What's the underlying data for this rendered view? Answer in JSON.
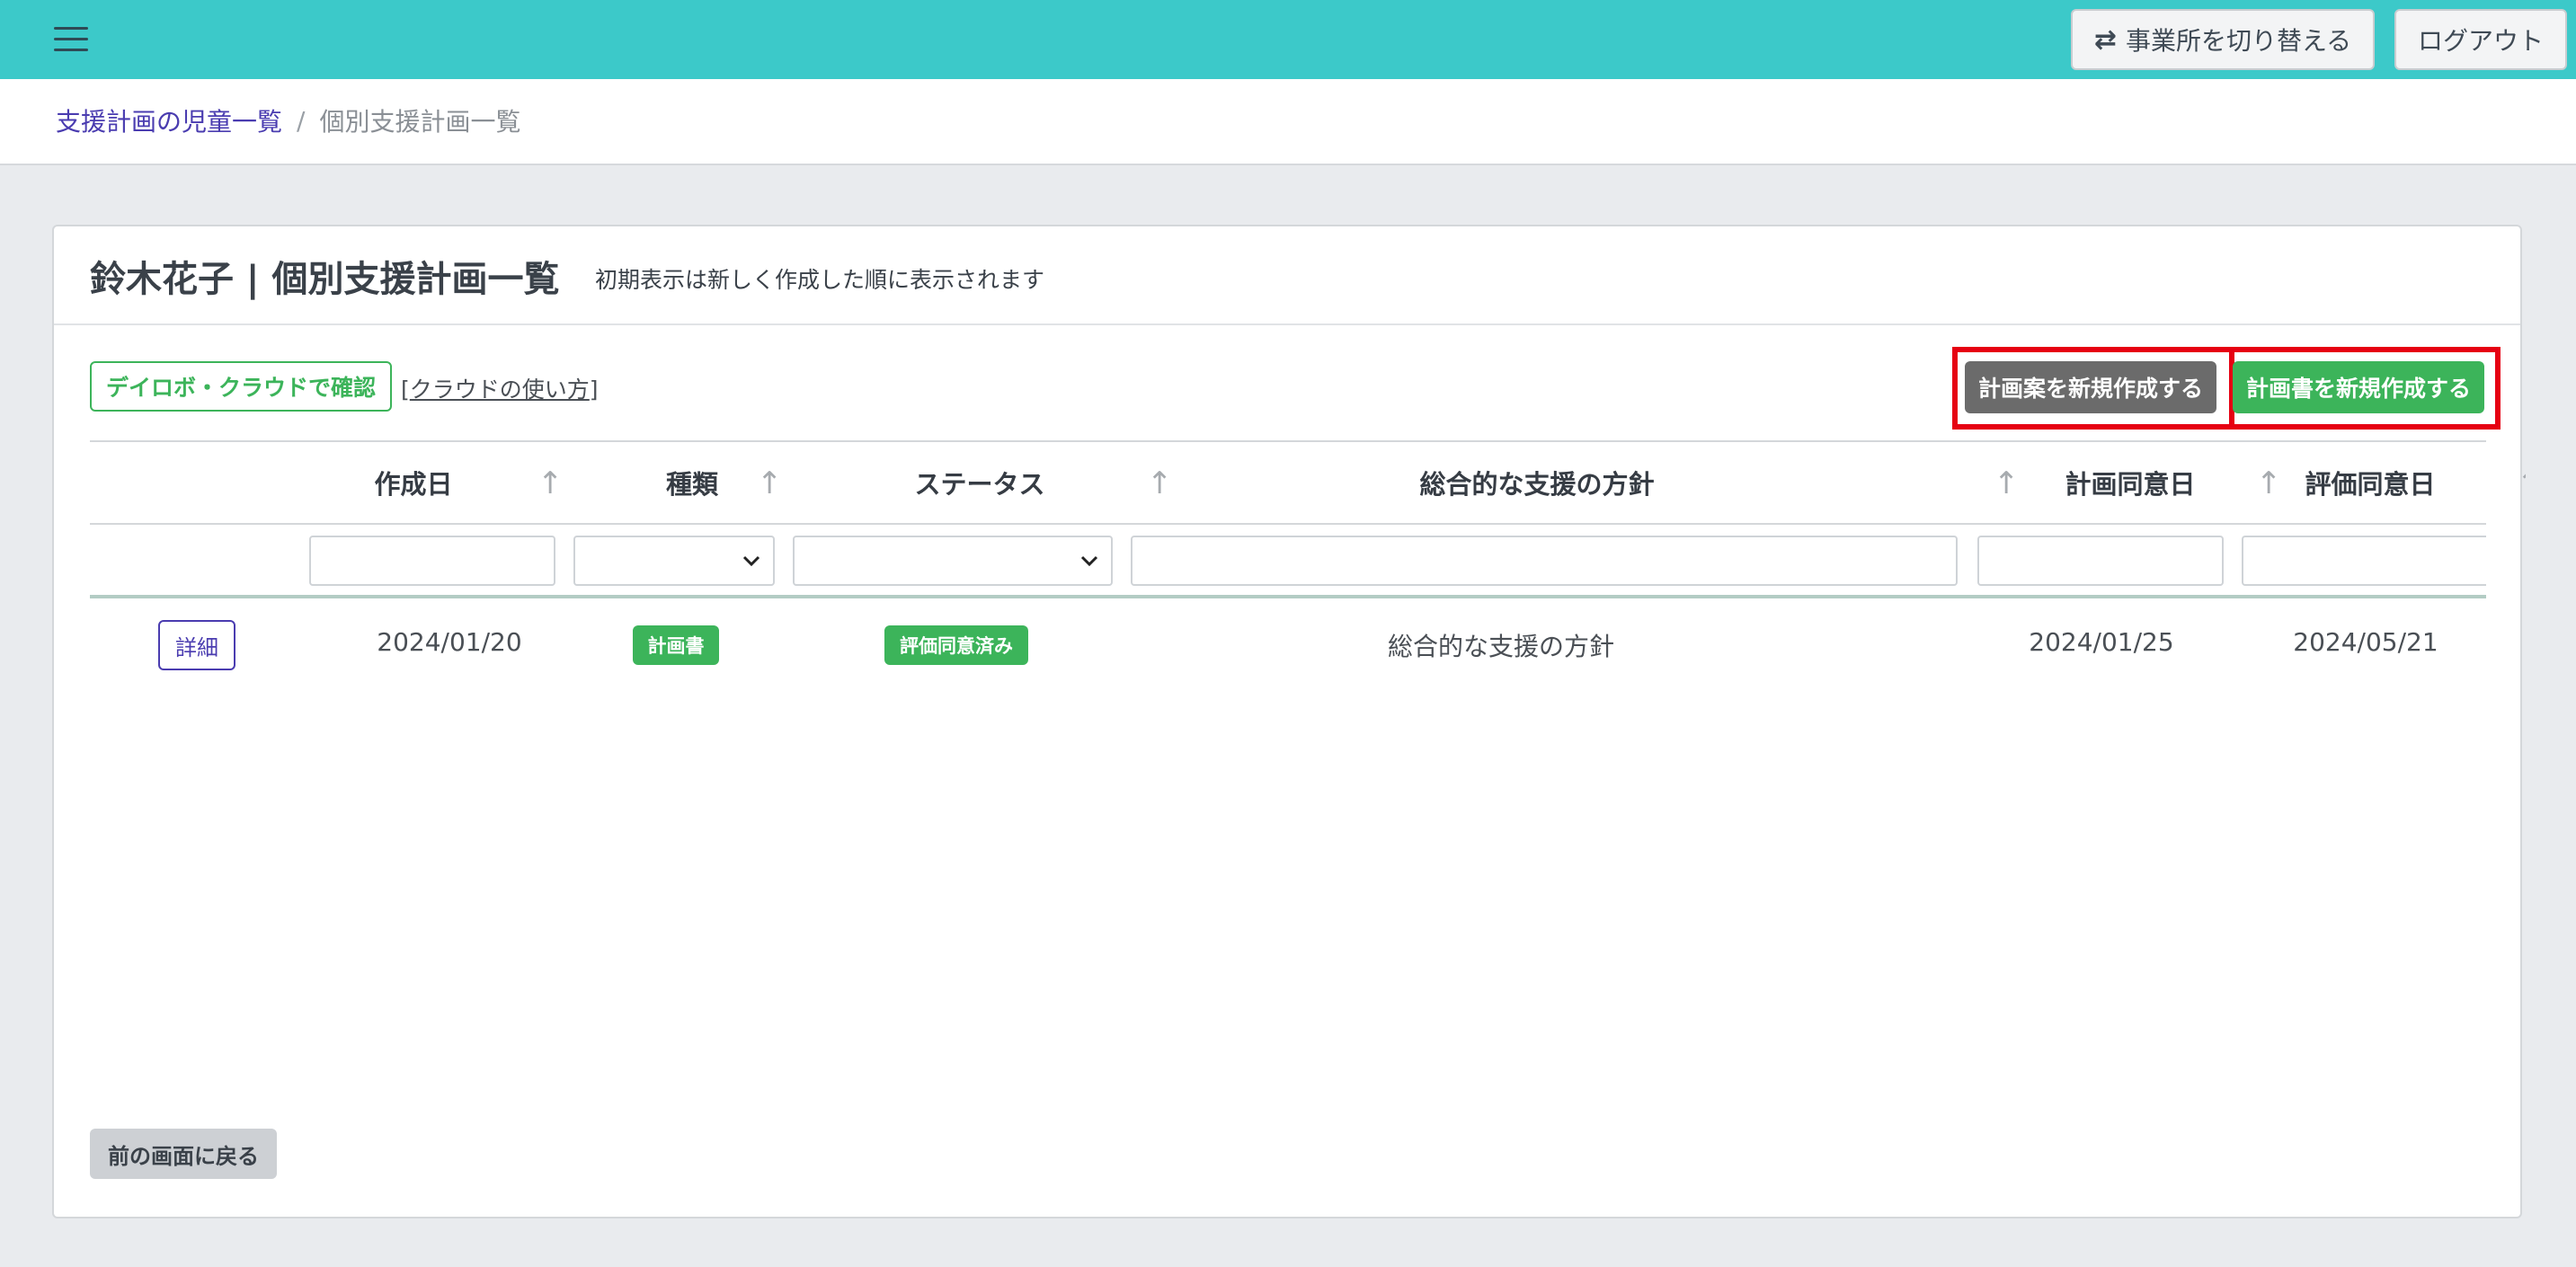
{
  "header": {
    "switch_office_label": "事業所を切り替える",
    "switch_icon": "⇄",
    "logout_label": "ログアウト"
  },
  "breadcrumb": {
    "parent": "支援計画の児童一覧",
    "separator": "/",
    "current": "個別支援計画一覧"
  },
  "card": {
    "title": "鈴木花子 | 個別支援計画一覧",
    "subtitle": "初期表示は新しく作成した順に表示されます",
    "cloud_button": "デイロボ・クラウドで確認",
    "cloud_help_open": "[",
    "cloud_help_link": "クラウドの使い方",
    "cloud_help_close": "]",
    "new_draft_button": "計画案を新規作成する",
    "new_plan_button": "計画書を新規作成する",
    "back_button": "前の画面に戻る"
  },
  "table": {
    "sort_icon": "↑",
    "columns": [
      "作成日",
      "種類",
      "ステータス",
      "総合的な支援の方針",
      "計画同意日",
      "評価同意日"
    ],
    "rows": [
      {
        "detail_label": "詳細",
        "created": "2024/01/20",
        "type": "計画書",
        "status": "評価同意済み",
        "policy": "総合的な支援の方針",
        "plan_agreed": "2024/01/25",
        "eval_agreed": "2024/05/21"
      }
    ]
  },
  "colors": {
    "topbar": "#3cc9c9",
    "green": "#3cb45a",
    "grey_button": "#6b6b6b",
    "highlight": "#e60012",
    "link": "#4a3cb0"
  }
}
